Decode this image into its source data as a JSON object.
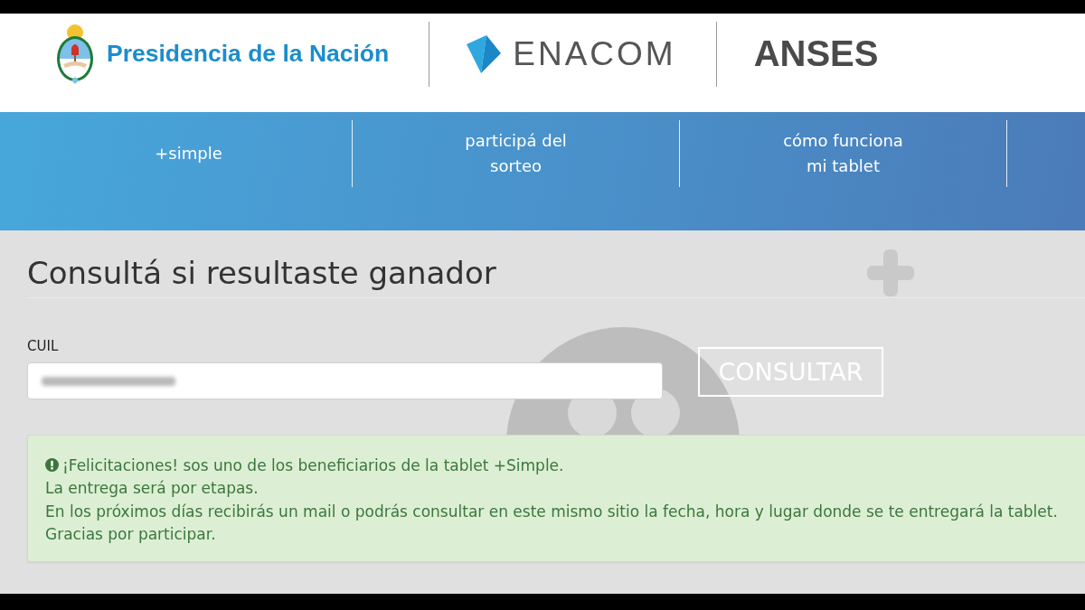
{
  "header": {
    "logos": [
      {
        "kind": "emblem",
        "text": "Presidencia de la Nación"
      },
      {
        "kind": "mark",
        "text": "ENACOM"
      },
      {
        "kind": "plain",
        "text": "ANSES"
      }
    ]
  },
  "nav": {
    "items": [
      {
        "label": "+simple"
      },
      {
        "label": "participá del sorteo"
      },
      {
        "label": "cómo funciona mi tablet"
      }
    ]
  },
  "form": {
    "title": "Consultá si resultaste ganador",
    "field": {
      "label": "CUIL",
      "value_obscured": true
    },
    "button": "CONSULTAR"
  },
  "alert": {
    "kind": "success",
    "lines": [
      "¡Felicitaciones! sos uno de los beneficiarios de la tablet +Simple.",
      "La entrega será por etapas.",
      "En los próximos días recibirás un mail o podrás consultar en este mismo sitio la fecha, hora y lugar donde se te entregará la tablet.",
      "Gracias por participar."
    ]
  }
}
